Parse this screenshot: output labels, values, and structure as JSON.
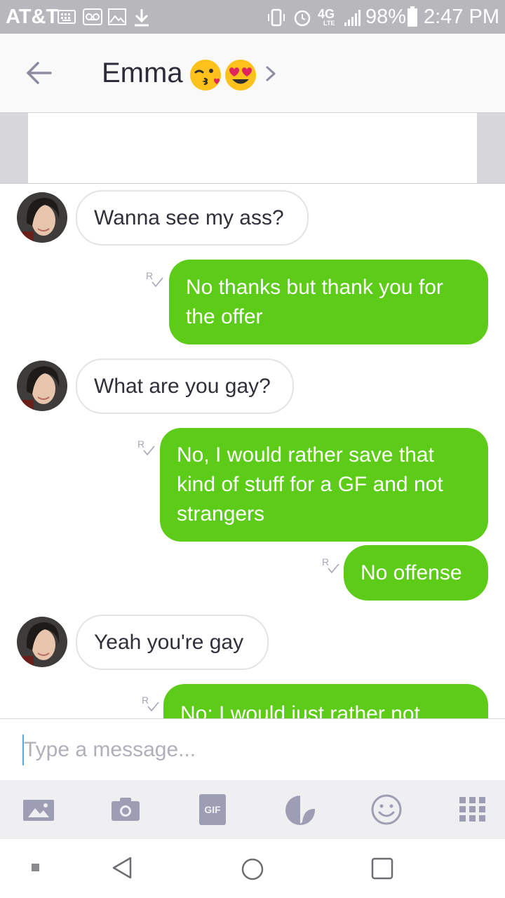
{
  "status_bar": {
    "carrier": "AT&T",
    "battery_percent": "98%",
    "time": "2:47 PM",
    "network_label": "4G",
    "network_sub": "LTE",
    "icons": [
      "keyboard-icon",
      "voicemail-icon",
      "image-icon",
      "download-icon",
      "vibrate-icon",
      "alarm-icon",
      "4g-lte-icon",
      "signal-icon",
      "battery-icon"
    ]
  },
  "header": {
    "contact_name": "Emma",
    "emojis": [
      "kissing-face-emoji",
      "heart-eyes-emoji"
    ]
  },
  "conversation": {
    "read_marker": "R",
    "messages": [
      {
        "direction": "incoming",
        "text": "Wanna see my ass?"
      },
      {
        "direction": "outgoing",
        "line1": "No thanks but thank you for",
        "line2": "the offer"
      },
      {
        "direction": "incoming",
        "text": "What are you gay?"
      },
      {
        "direction": "outgoing",
        "line1": "No, I would rather save that",
        "line2": "kind of stuff for a GF and not",
        "line3": "strangers"
      },
      {
        "direction": "outgoing",
        "text": "No offense"
      },
      {
        "direction": "incoming",
        "text": "Yeah you're gay"
      },
      {
        "direction": "outgoing",
        "text": "No; I would just rather not"
      }
    ]
  },
  "composer": {
    "placeholder": "Type a message..."
  },
  "toolbar": {
    "gif_label": "GIF",
    "icons": [
      "gallery-icon",
      "camera-icon",
      "gif-icon",
      "sticker-icon",
      "emoji-icon",
      "apps-grid-icon"
    ]
  },
  "colors": {
    "outgoing_bubble": "#5ccc18",
    "status_bar": "#b8b8bc",
    "icon_gray": "#9d9db4"
  }
}
